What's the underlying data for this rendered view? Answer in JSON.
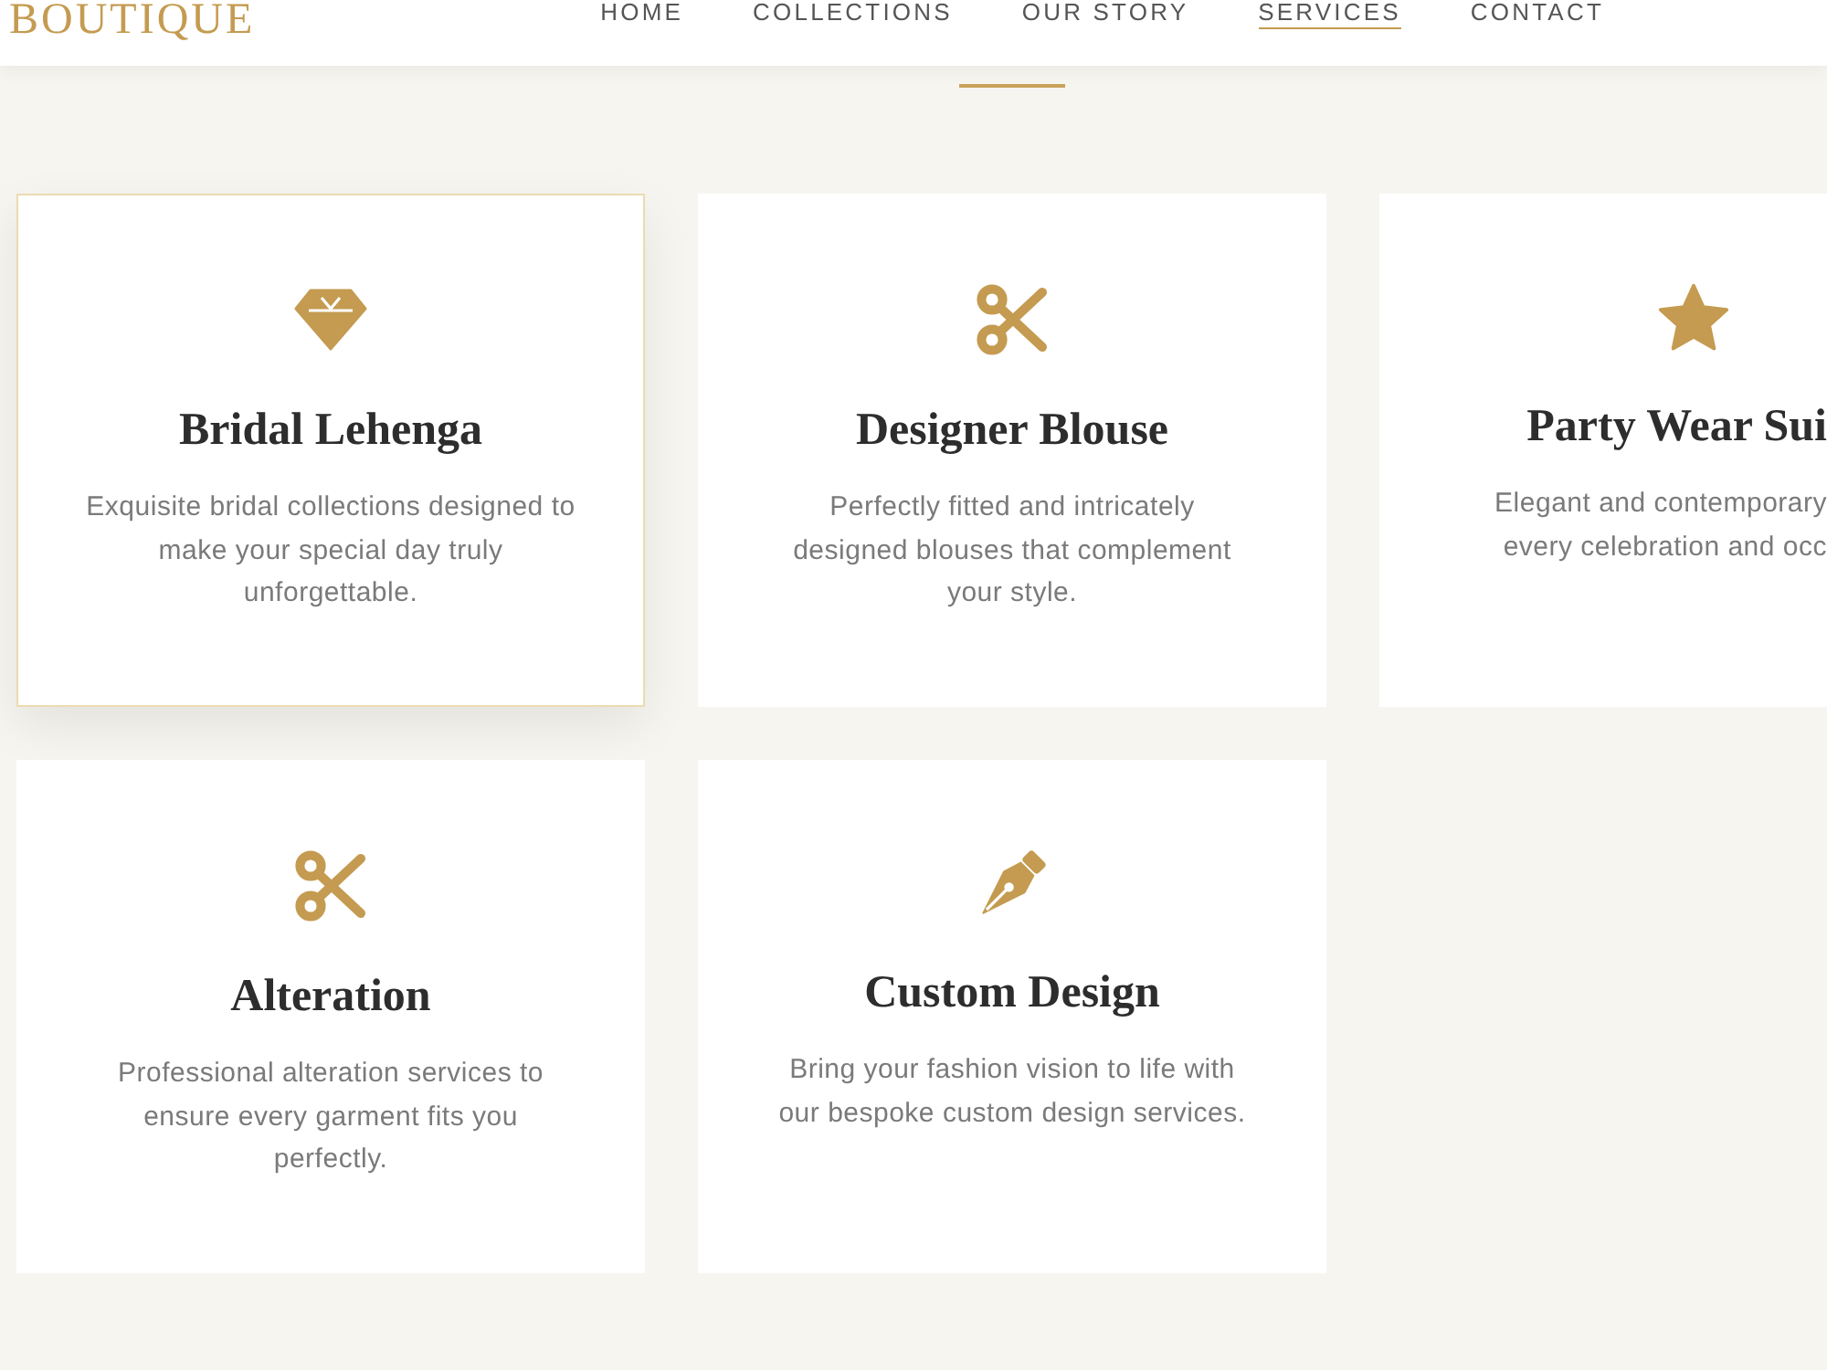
{
  "header": {
    "logo": "BOUTIQUE",
    "nav": [
      {
        "label": "HOME",
        "selected": false
      },
      {
        "label": "COLLECTIONS",
        "selected": false
      },
      {
        "label": "OUR STORY",
        "selected": false
      },
      {
        "label": "SERVICES",
        "selected": true
      },
      {
        "label": "CONTACT",
        "selected": false
      }
    ]
  },
  "services": {
    "cards": [
      {
        "kind": "gem",
        "title": "Bridal Lehenga",
        "description_lines": [
          "Exquisite bridal collections designed to",
          "make your special day truly",
          "unforgettable."
        ],
        "highlighted": true,
        "cut_off": false
      },
      {
        "kind": "scissors",
        "title": "Designer Blouse",
        "description_lines": [
          "Perfectly fitted and intricately",
          "designed blouses that complement",
          "your style."
        ],
        "highlighted": false,
        "cut_off": false
      },
      {
        "kind": "star",
        "title": "Party Wear Sui",
        "description_lines": [
          "Elegant and contemporary",
          "every celebration and occ"
        ],
        "highlighted": false,
        "cut_off": true
      },
      {
        "kind": "scissors",
        "title": "Alteration",
        "description_lines": [
          "Professional alteration services to",
          "ensure every garment fits you",
          "perfectly."
        ],
        "highlighted": false,
        "cut_off": false
      },
      {
        "kind": "pen",
        "title": "Custom Design",
        "description_lines": [
          "Bring your fashion vision to life with",
          "our bespoke custom design services."
        ],
        "highlighted": false,
        "cut_off": false
      }
    ]
  }
}
